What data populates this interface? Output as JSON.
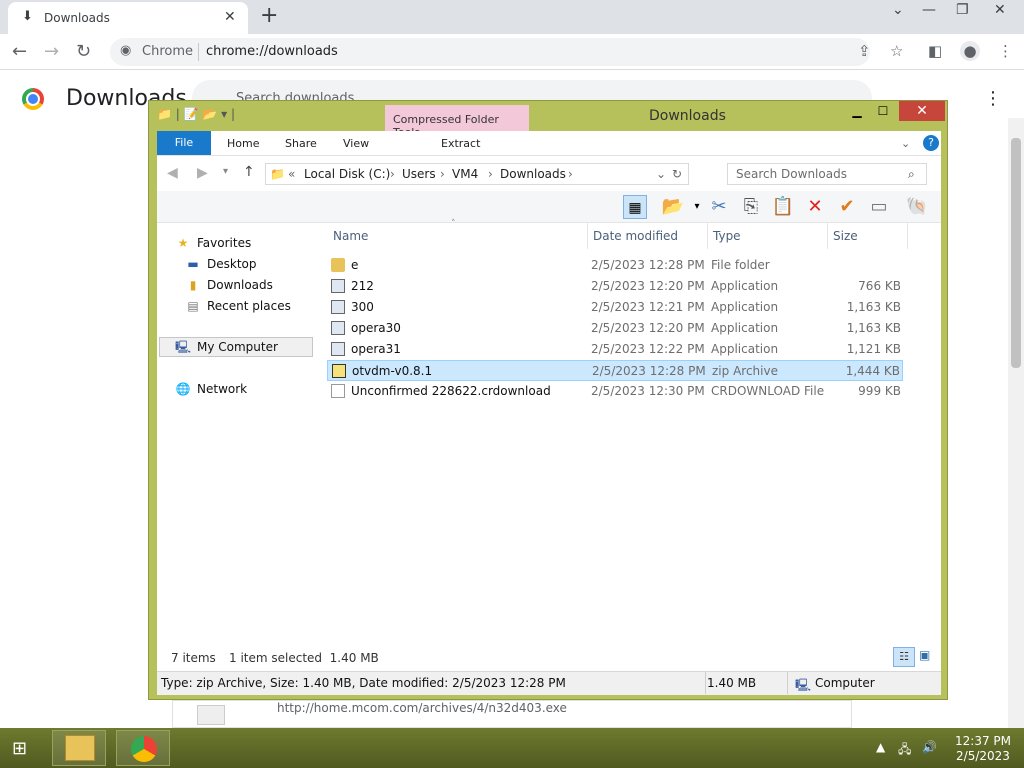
{
  "browser": {
    "tab_title": "Downloads",
    "omnibox_label": "Chrome",
    "url": "chrome://downloads",
    "page_title": "Downloads",
    "search_placeholder": "Search downloads",
    "bottom_entry_url": "http://home.mcom.com/archives/4/n32d403.exe"
  },
  "explorer": {
    "title": "Downloads",
    "context_tab": "Compressed Folder Tools",
    "ribbon_tabs": [
      "File",
      "Home",
      "Share",
      "View"
    ],
    "context_subtab": "Extract",
    "address_path": [
      "Local Disk (C:)",
      "Users",
      "VM4",
      "Downloads"
    ],
    "search_placeholder": "Search Downloads",
    "nav": {
      "favorites": "Favorites",
      "desktop": "Desktop",
      "downloads": "Downloads",
      "recent": "Recent places",
      "computer": "My Computer",
      "network": "Network"
    },
    "columns": [
      "Name",
      "Date modified",
      "Type",
      "Size"
    ],
    "files": [
      {
        "name": "e",
        "date": "2/5/2023 12:28 PM",
        "type": "File folder",
        "size": ""
      },
      {
        "name": "212",
        "date": "2/5/2023 12:20 PM",
        "type": "Application",
        "size": "766 KB"
      },
      {
        "name": "300",
        "date": "2/5/2023 12:21 PM",
        "type": "Application",
        "size": "1,163 KB"
      },
      {
        "name": "opera30",
        "date": "2/5/2023 12:20 PM",
        "type": "Application",
        "size": "1,163 KB"
      },
      {
        "name": "opera31",
        "date": "2/5/2023 12:22 PM",
        "type": "Application",
        "size": "1,121 KB"
      },
      {
        "name": "otvdm-v0.8.1",
        "date": "2/5/2023 12:28 PM",
        "type": "zip Archive",
        "size": "1,444 KB"
      },
      {
        "name": "Unconfirmed 228622.crdownload",
        "date": "2/5/2023 12:30 PM",
        "type": "CRDOWNLOAD File",
        "size": "999 KB"
      }
    ],
    "status_items": "7 items",
    "status_selected": "1 item selected  1.40 MB",
    "details_text": "Type: zip Archive, Size: 1.40 MB, Date modified: 2/5/2023 12:28 PM",
    "details_size": "1.40 MB",
    "details_location": "Computer"
  },
  "taskbar": {
    "time": "12:37 PM",
    "date": "2/5/2023"
  }
}
